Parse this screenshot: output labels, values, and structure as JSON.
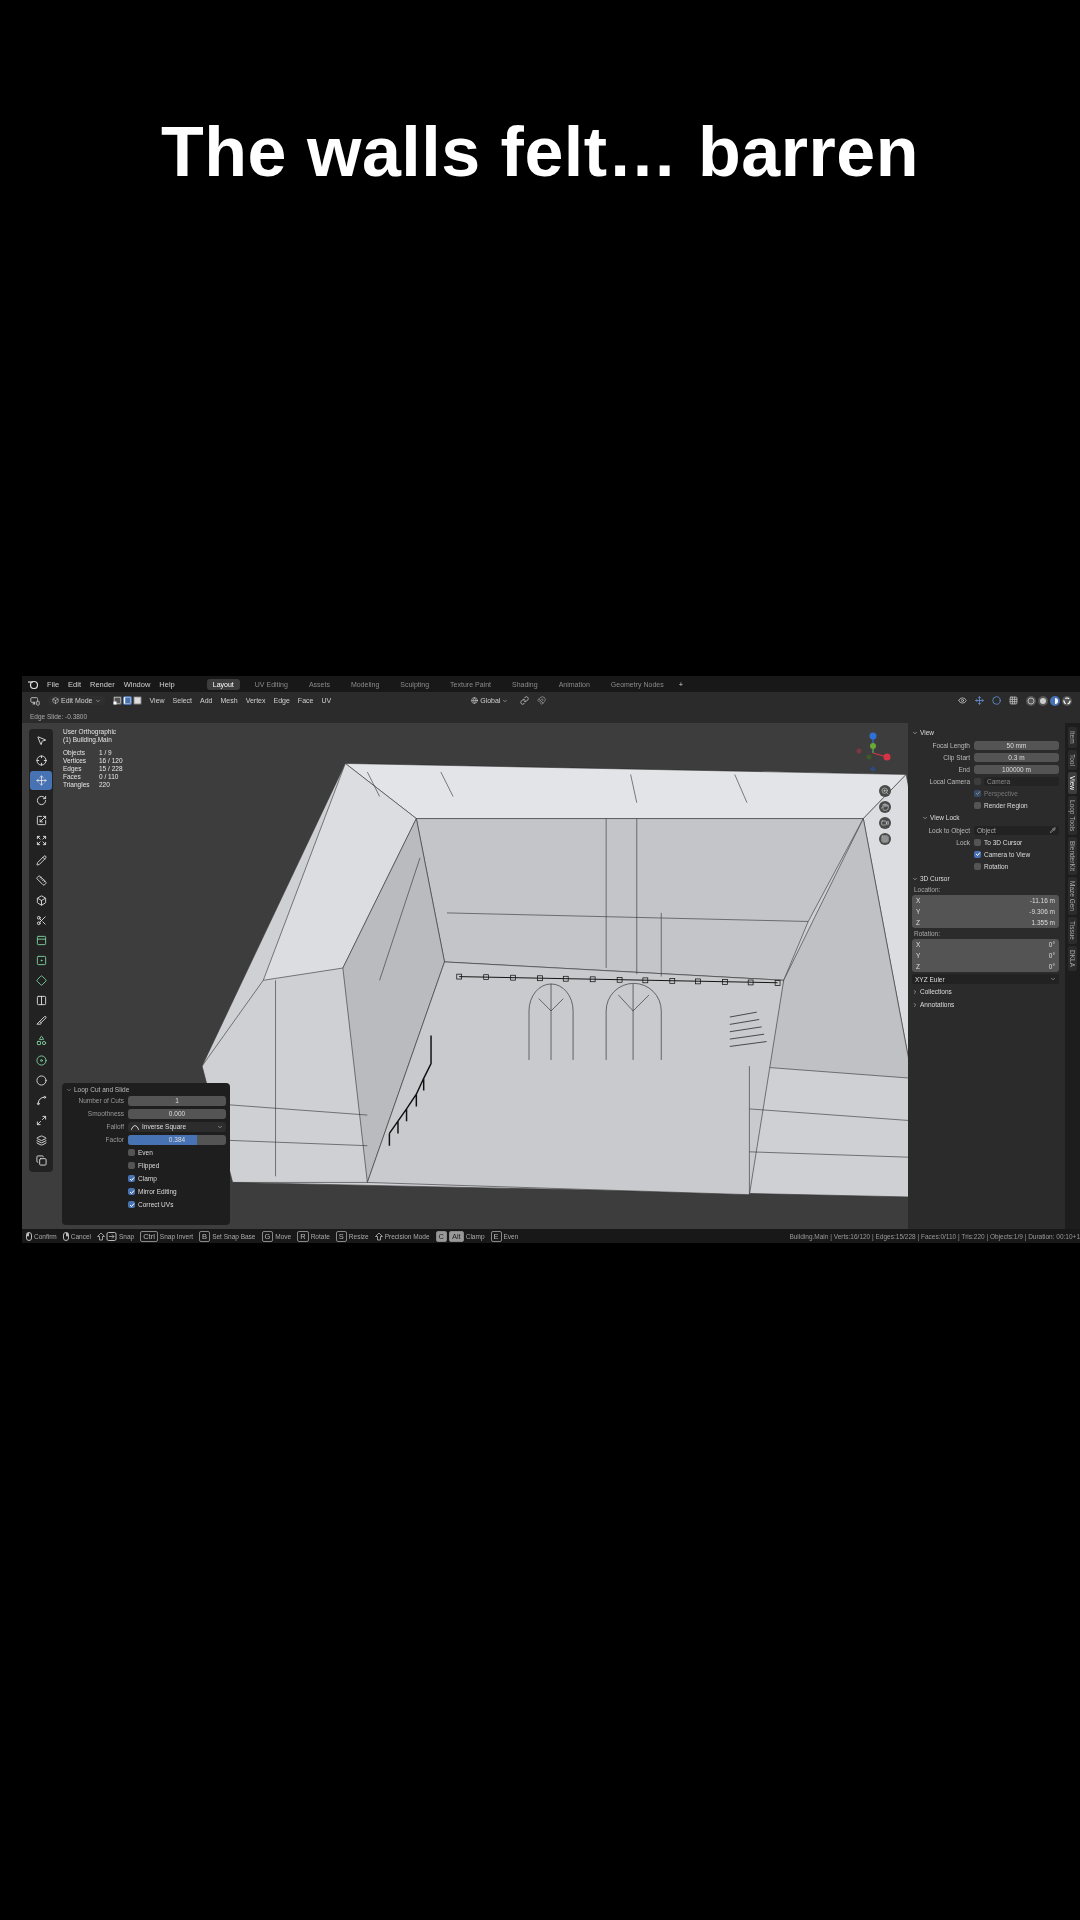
{
  "caption": "The walls felt… barren",
  "menu_bar": {
    "menus": [
      "File",
      "Edit",
      "Render",
      "Window",
      "Help"
    ],
    "workspaces": [
      {
        "label": "Layout",
        "selected": true
      },
      {
        "label": "UV Editing",
        "selected": false
      },
      {
        "label": "Assets",
        "selected": false
      },
      {
        "label": "Modeling",
        "selected": false
      },
      {
        "label": "Sculpting",
        "selected": false
      },
      {
        "label": "Texture Paint",
        "selected": false
      },
      {
        "label": "Shading",
        "selected": false
      },
      {
        "label": "Animation",
        "selected": false
      },
      {
        "label": "Geometry Nodes",
        "selected": false
      }
    ],
    "add_tab": "+"
  },
  "header": {
    "mode": "Edit Mode",
    "select_modes": [
      {
        "kind": "vertex",
        "selected": false
      },
      {
        "kind": "edge",
        "selected": true
      },
      {
        "kind": "face",
        "selected": false
      }
    ],
    "menus": [
      "View",
      "Select",
      "Add",
      "Mesh",
      "Vertex",
      "Edge",
      "Face",
      "UV"
    ],
    "orientation": "Global",
    "shading_modes": [
      {
        "kind": "wireframe",
        "selected": false
      },
      {
        "kind": "solid",
        "selected": false
      },
      {
        "kind": "material",
        "selected": true
      },
      {
        "kind": "rendered",
        "selected": false
      }
    ]
  },
  "operator_status": "Edge Slide: -0.3800",
  "tools": [
    {
      "kind": "select",
      "selected": false
    },
    {
      "kind": "cursor",
      "selected": false
    },
    {
      "kind": "move",
      "selected": true
    },
    {
      "kind": "rotate",
      "selected": false
    },
    {
      "kind": "scale",
      "selected": false
    },
    {
      "kind": "transform",
      "selected": false
    },
    {
      "kind": "annotate",
      "selected": false
    },
    {
      "kind": "measure",
      "selected": false
    },
    {
      "kind": "add-cube",
      "selected": false
    },
    {
      "kind": "cut",
      "selected": false
    },
    {
      "kind": "extrude",
      "selected": false
    },
    {
      "kind": "inset",
      "selected": false
    },
    {
      "kind": "bevel",
      "selected": false
    },
    {
      "kind": "loop-cut",
      "selected": false
    },
    {
      "kind": "knife",
      "selected": false
    },
    {
      "kind": "poly-build",
      "selected": false
    },
    {
      "kind": "spin",
      "selected": false
    },
    {
      "kind": "smooth",
      "selected": false
    },
    {
      "kind": "edge-slide",
      "selected": false
    },
    {
      "kind": "shrink",
      "selected": false
    },
    {
      "kind": "shear",
      "selected": false
    },
    {
      "kind": "rip",
      "selected": false
    }
  ],
  "viewport": {
    "view_name": "User Orthographic",
    "object_name": "(1) Building.Main",
    "stats": [
      {
        "label": "Objects",
        "value": "1 / 9"
      },
      {
        "label": "Vertices",
        "value": "16 / 120"
      },
      {
        "label": "Edges",
        "value": "15 / 228"
      },
      {
        "label": "Faces",
        "value": "0 / 110"
      },
      {
        "label": "Triangles",
        "value": "220"
      }
    ]
  },
  "operator_panel": {
    "title": "Loop Cut and Slide",
    "expanded": true,
    "fields": [
      {
        "kind": "number",
        "label": "Number of Cuts",
        "value": "1"
      },
      {
        "kind": "number",
        "label": "Smoothness",
        "value": "0.000"
      },
      {
        "kind": "dropdown",
        "label": "Falloff",
        "value": "Inverse Square"
      },
      {
        "kind": "slider",
        "label": "Factor",
        "value": "0.384",
        "level": 0.7
      },
      {
        "kind": "checkbox",
        "label": "Even",
        "checked": false
      },
      {
        "kind": "checkbox",
        "label": "Flipped",
        "checked": false
      },
      {
        "kind": "checkbox",
        "label": "Clamp",
        "checked": true
      },
      {
        "kind": "checkbox",
        "label": "Mirror Editing",
        "checked": true
      },
      {
        "kind": "checkbox",
        "label": "Correct UVs",
        "checked": true
      }
    ]
  },
  "sidebar": {
    "sections": [
      {
        "title": "View",
        "expanded": true,
        "rows": [
          {
            "kind": "field",
            "label": "Focal Length",
            "value": "50 mm"
          },
          {
            "kind": "field",
            "label": "Clip Start",
            "value": "0.3 m"
          },
          {
            "kind": "field",
            "label": "End",
            "value": "100000 m"
          },
          {
            "kind": "object_field",
            "label": "Local Camera",
            "placeholder": "Camera",
            "checked": false,
            "disabled": true
          },
          {
            "kind": "checkbox",
            "label": "Perspective",
            "checked": true,
            "disabled": true
          },
          {
            "kind": "checkbox",
            "label": "Render Region",
            "checked": false,
            "disabled": false
          },
          {
            "kind": "subheader",
            "label": "View Lock",
            "expanded": true
          },
          {
            "kind": "object_field",
            "label": "Lock to Object",
            "placeholder": "Object",
            "disabled": false
          },
          {
            "kind": "checkbox",
            "group_label": "Lock",
            "label": "To 3D Cursor",
            "checked": false,
            "disabled": false
          },
          {
            "kind": "checkbox",
            "label": "Camera to View",
            "checked": true,
            "disabled": false
          },
          {
            "kind": "checkbox",
            "label": "Rotation",
            "checked": false,
            "disabled": false
          }
        ]
      },
      {
        "title": "3D Cursor",
        "expanded": true,
        "rows": [
          {
            "kind": "caption",
            "label": "Location:"
          },
          {
            "kind": "vector",
            "items": [
              {
                "axis": "X",
                "value": "-11.16 m"
              },
              {
                "axis": "Y",
                "value": "-9.306 m"
              },
              {
                "axis": "Z",
                "value": "1.355 m"
              }
            ]
          },
          {
            "kind": "caption",
            "label": "Rotation:"
          },
          {
            "kind": "vector",
            "items": [
              {
                "axis": "X",
                "value": "0°"
              },
              {
                "axis": "Y",
                "value": "0°"
              },
              {
                "axis": "Z",
                "value": "0°"
              }
            ]
          },
          {
            "kind": "dropdown",
            "value": "XYZ Euler"
          }
        ]
      },
      {
        "title": "Collections",
        "expanded": false
      },
      {
        "title": "Annotations",
        "expanded": false
      }
    ]
  },
  "sidebar_tabs": [
    {
      "label": "Item",
      "selected": false
    },
    {
      "label": "Tool",
      "selected": false
    },
    {
      "label": "View",
      "selected": true
    },
    {
      "label": "Loop Tools",
      "selected": false
    },
    {
      "label": "BlenderKit",
      "selected": false
    },
    {
      "label": "Maze Gen",
      "selected": false
    },
    {
      "label": "Tissue",
      "selected": false
    },
    {
      "label": "DKLA",
      "selected": false
    }
  ],
  "status_bar": {
    "hints": [
      {
        "kind": "mouse-left",
        "label": "Confirm"
      },
      {
        "kind": "mouse-right",
        "label": "Cancel"
      },
      {
        "kind": "shift-tab",
        "label": "Snap"
      },
      {
        "kind": "key",
        "keys": [
          "Ctrl"
        ],
        "label": "Snap Invert",
        "pressed": false
      },
      {
        "kind": "key",
        "keys": [
          "B"
        ],
        "label": "Set Snap Base",
        "pressed": false
      },
      {
        "kind": "key",
        "keys": [
          "G"
        ],
        "label": "Move",
        "pressed": false
      },
      {
        "kind": "key",
        "keys": [
          "R"
        ],
        "label": "Rotate",
        "pressed": false
      },
      {
        "kind": "key",
        "keys": [
          "S"
        ],
        "label": "Resize",
        "pressed": false
      },
      {
        "kind": "shift",
        "label": "Precision Mode"
      },
      {
        "kind": "key",
        "keys": [
          "C",
          "Alt"
        ],
        "label": "Clamp",
        "pressed": true
      },
      {
        "kind": "key",
        "keys": [
          "E"
        ],
        "label": "Even",
        "pressed": false
      }
    ],
    "scene_stats": "Building.Main | Verts:16/120 | Edges:15/228 | Faces:0/110 | Tris:220 | Objects:1/9 | Duration: 00:10+1"
  }
}
